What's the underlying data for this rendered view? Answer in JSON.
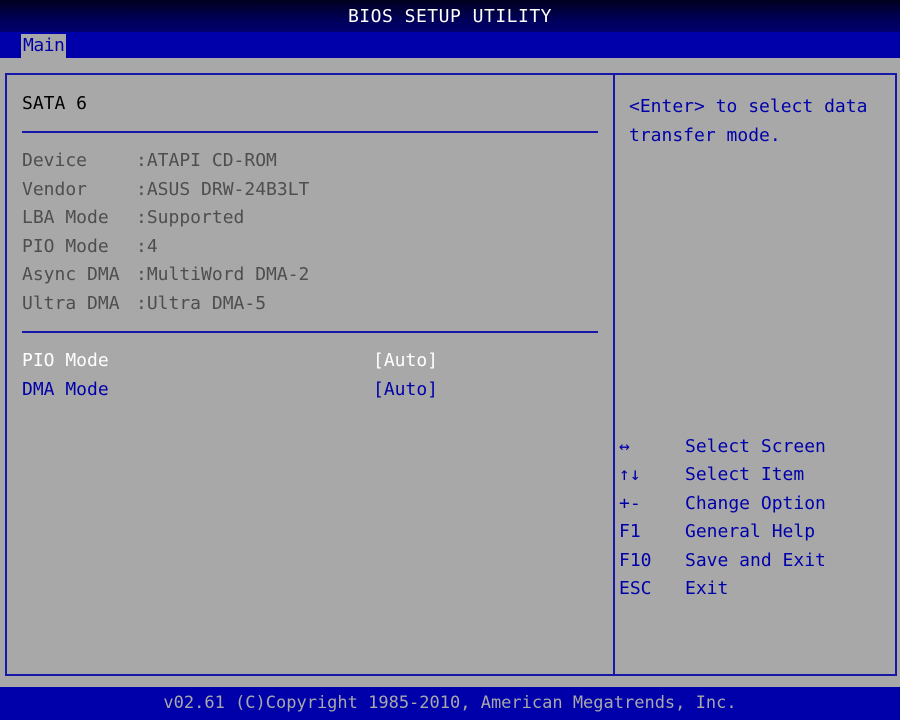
{
  "header": {
    "title": "BIOS SETUP UTILITY"
  },
  "menu": {
    "tabs": [
      {
        "label": "Main",
        "active": true
      }
    ]
  },
  "main": {
    "section_title": "SATA 6",
    "device_info": [
      {
        "label": "Device",
        "value": ":ATAPI CD-ROM"
      },
      {
        "label": "Vendor",
        "value": ":ASUS DRW-24B3LT"
      },
      {
        "label": "LBA Mode",
        "value": ":Supported"
      },
      {
        "label": "PIO Mode",
        "value": ":4"
      },
      {
        "label": "Async DMA",
        "value": ":MultiWord DMA-2"
      },
      {
        "label": "Ultra DMA",
        "value": ":Ultra DMA-5"
      }
    ],
    "settings": [
      {
        "label": "PIO Mode",
        "value": "[Auto]",
        "selected": true
      },
      {
        "label": "DMA Mode",
        "value": "[Auto]",
        "selected": false
      }
    ]
  },
  "help": {
    "text": "<Enter> to select data transfer mode."
  },
  "keys": [
    {
      "key": "↔",
      "icon": "left-right-arrow-icon",
      "desc": "Select Screen"
    },
    {
      "key": "↑↓",
      "icon": "up-down-arrows-icon",
      "desc": "Select Item"
    },
    {
      "key": "+-",
      "icon": "plus-minus-icon",
      "desc": "Change Option"
    },
    {
      "key": "F1",
      "icon": null,
      "desc": "General Help"
    },
    {
      "key": "F10",
      "icon": null,
      "desc": "Save and Exit"
    },
    {
      "key": "ESC",
      "icon": null,
      "desc": "Exit"
    }
  ],
  "footer": {
    "text": "v02.61 (C)Copyright 1985-2010, American Megatrends, Inc."
  },
  "colors": {
    "background": "#a8a8a8",
    "accent_blue": "#0000aa",
    "title_bar": "#000058",
    "selected_text": "#ffffff",
    "info_text": "#4e4e4e"
  }
}
